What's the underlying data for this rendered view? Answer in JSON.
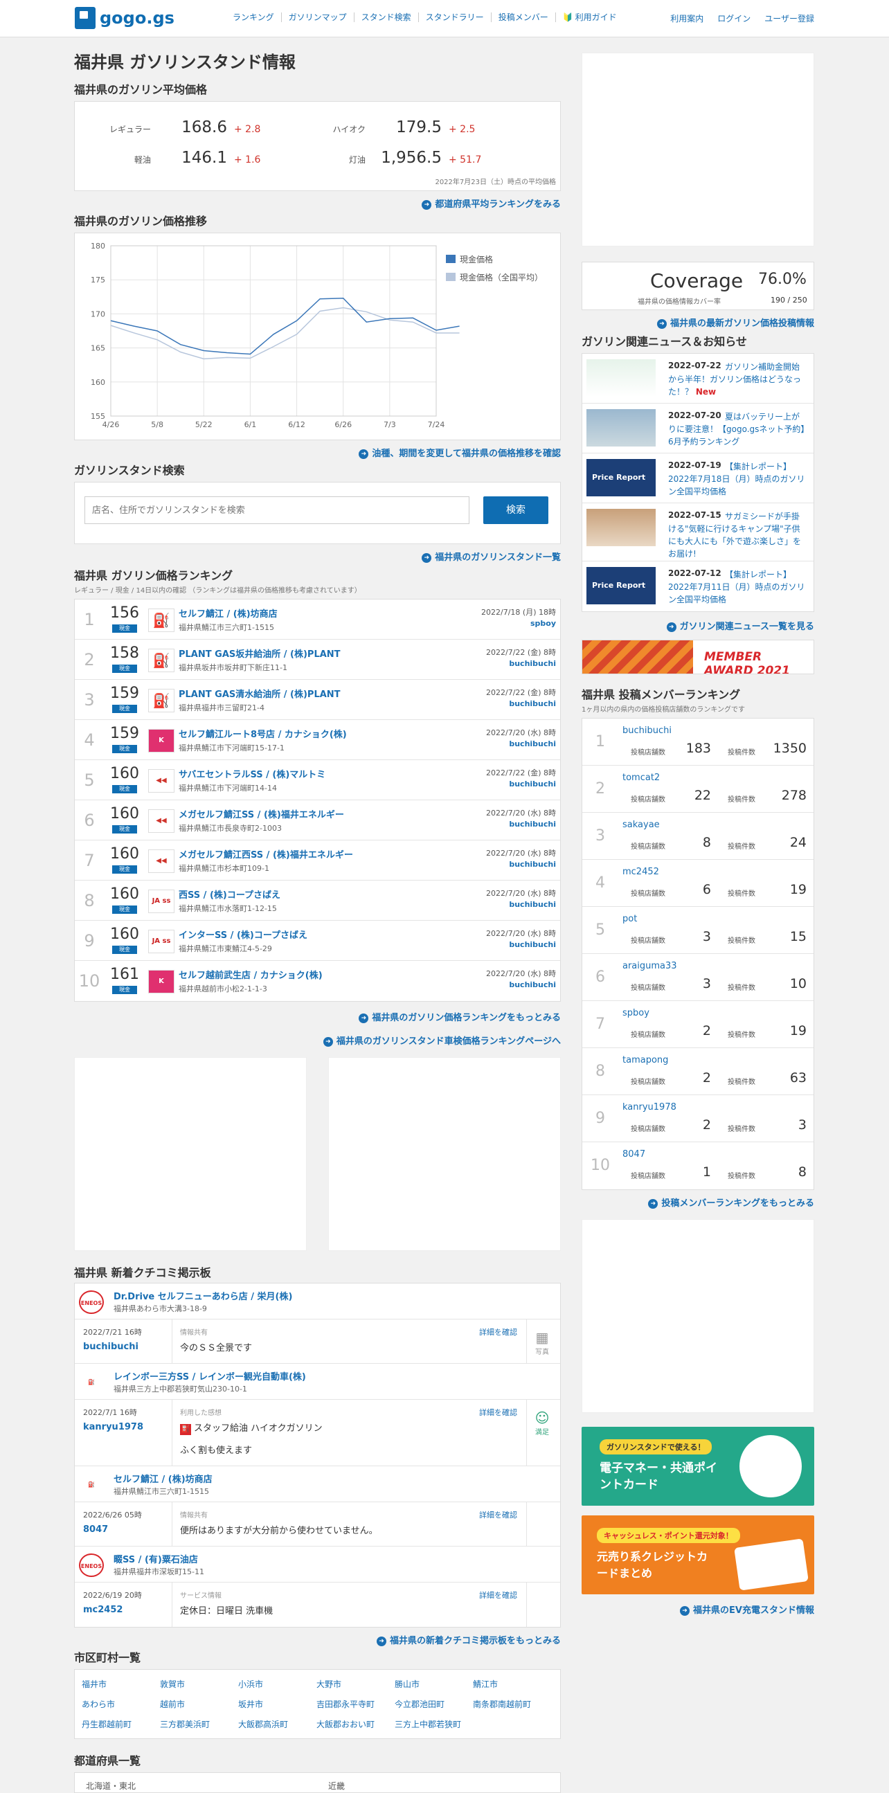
{
  "header": {
    "logo": "gogo.gs",
    "nav": [
      "ランキング",
      "ガソリンマップ",
      "スタンド検索",
      "スタンドラリー",
      "投稿メンバー",
      "利用ガイド"
    ],
    "right": [
      "利用案内",
      "ログイン",
      "ユーザー登録"
    ]
  },
  "page": {
    "title": "福井県 ガソリンスタンド情報"
  },
  "avg": {
    "heading": "福井県のガソリン平均価格",
    "items": [
      {
        "label": "レギュラー",
        "value": "168.6",
        "diff": "+ 2.8"
      },
      {
        "label": "ハイオク",
        "value": "179.5",
        "diff": "+ 2.5"
      },
      {
        "label": "軽油",
        "value": "146.1",
        "diff": "+ 1.6"
      },
      {
        "label": "灯油",
        "value": "1,956.5",
        "diff": "+ 51.7"
      }
    ],
    "note": "2022年7月23日（土）時点の平均価格",
    "more": "都道府県平均ランキングをみる"
  },
  "chart": {
    "heading": "福井県のガソリン価格推移",
    "more": "油種、期間を変更して福井県の価格推移を確認"
  },
  "chart_data": {
    "type": "line",
    "title": "",
    "xlabel": "",
    "ylabel": "",
    "ylim": [
      155,
      180
    ],
    "yticks": [
      "180",
      "175",
      "170",
      "165",
      "160",
      "155"
    ],
    "x": [
      "4/26",
      "5/8",
      "5/22",
      "6/1",
      "6/12",
      "6/26",
      "7/3",
      "7/24"
    ],
    "grid": true,
    "legend": "top-right",
    "series": [
      {
        "name": "現金価格",
        "color": "#3a76b8",
        "points": [
          [
            0,
            169
          ],
          [
            0.5,
            168.2
          ],
          [
            1,
            167.5
          ],
          [
            1.5,
            165.5
          ],
          [
            2,
            164.6
          ],
          [
            2.5,
            164.3
          ],
          [
            3,
            164.1
          ],
          [
            3.5,
            167
          ],
          [
            4,
            169
          ],
          [
            4.5,
            172.2
          ],
          [
            5,
            172.3
          ],
          [
            5.5,
            168.8
          ],
          [
            6,
            169.3
          ],
          [
            6.5,
            169.4
          ],
          [
            7,
            167.6
          ],
          [
            7.5,
            168.2
          ]
        ]
      },
      {
        "name": "現金価格（全国平均）",
        "color": "#b7c6dc",
        "points": [
          [
            0,
            168.3
          ],
          [
            0.5,
            167.2
          ],
          [
            1,
            166.2
          ],
          [
            1.5,
            164.4
          ],
          [
            2,
            163.4
          ],
          [
            2.5,
            163.6
          ],
          [
            3,
            163.5
          ],
          [
            3.5,
            165.2
          ],
          [
            4,
            167
          ],
          [
            4.5,
            170.4
          ],
          [
            5,
            170.9
          ],
          [
            5.5,
            170.3
          ],
          [
            6,
            169.1
          ],
          [
            6.5,
            168.8
          ],
          [
            7,
            167.2
          ],
          [
            7.5,
            167.2
          ]
        ]
      }
    ]
  },
  "search": {
    "heading": "ガソリンスタンド検索",
    "placeholder": "店名、住所でガソリンスタンドを検索",
    "button": "検索",
    "more": "福井県のガソリンスタンド一覧"
  },
  "ranking": {
    "heading": "福井県 ガソリン価格ランキング",
    "sub": "レギュラー / 現金 / 14日以内の確認 （ランキングは福井県の価格推移も考慮されています）",
    "tag": "現金",
    "rows": [
      {
        "no": "1",
        "price": "156",
        "name": "セルフ鯖江 / (株)坊商店",
        "addr": "福井県鯖江市三六町1-1515",
        "date": "2022/7/18 (月) 18時",
        "user": "spboy",
        "icon": "pump"
      },
      {
        "no": "2",
        "price": "158",
        "name": "PLANT GAS坂井給油所 / (株)PLANT",
        "addr": "福井県坂井市坂井町下新庄11-1",
        "date": "2022/7/22 (金) 8時",
        "user": "buchibuchi",
        "icon": "pump"
      },
      {
        "no": "3",
        "price": "159",
        "name": "PLANT GAS清水給油所 / (株)PLANT",
        "addr": "福井県福井市三留町21-4",
        "date": "2022/7/22 (金) 8時",
        "user": "buchibuchi",
        "icon": "pump"
      },
      {
        "no": "4",
        "price": "159",
        "name": "セルフ鯖江ルート8号店 / カナショク(株)",
        "addr": "福井県鯖江市下河端町15-17-1",
        "date": "2022/7/20 (水) 8時",
        "user": "buchibuchi",
        "icon": "kana"
      },
      {
        "no": "5",
        "price": "160",
        "name": "サバエセントラルSS / (株)マルトミ",
        "addr": "福井県鯖江市下河端町14-14",
        "date": "2022/7/22 (金) 8時",
        "user": "buchibuchi",
        "icon": "apollo"
      },
      {
        "no": "6",
        "price": "160",
        "name": "メガセルフ鯖江SS / (株)福井エネルギー",
        "addr": "福井県鯖江市長泉寺町2-1003",
        "date": "2022/7/20 (水) 8時",
        "user": "buchibuchi",
        "icon": "apollo"
      },
      {
        "no": "7",
        "price": "160",
        "name": "メガセルフ鯖江西SS / (株)福井エネルギー",
        "addr": "福井県鯖江市杉本町109-1",
        "date": "2022/7/20 (水) 8時",
        "user": "buchibuchi",
        "icon": "apollo"
      },
      {
        "no": "8",
        "price": "160",
        "name": "西SS / (株)コープさばえ",
        "addr": "福井県鯖江市水落町1-12-15",
        "date": "2022/7/20 (水) 8時",
        "user": "buchibuchi",
        "icon": "ja"
      },
      {
        "no": "9",
        "price": "160",
        "name": "インターSS / (株)コープさばえ",
        "addr": "福井県鯖江市東鯖江4-5-29",
        "date": "2022/7/20 (水) 8時",
        "user": "buchibuchi",
        "icon": "ja"
      },
      {
        "no": "10",
        "price": "161",
        "name": "セルフ越前武生店 / カナショク(株)",
        "addr": "福井県越前市小松2-1-1-3",
        "date": "2022/7/20 (水) 8時",
        "user": "buchibuchi",
        "icon": "kana"
      }
    ],
    "more1": "福井県のガソリン価格ランキングをもっとみる",
    "more2": "福井県のガソリンスタンド車検価格ランキングページへ"
  },
  "bbs": {
    "heading": "福井県 新着クチコミ掲示板",
    "detail": "詳細を確認",
    "items": [
      {
        "shop": "Dr.Drive セルフニューあわら店 / 栄月(株)",
        "addr": "福井県あわら市大溝3-18-9",
        "icon": "eneos",
        "date": "2022/7/21 16時",
        "user": "buchibuchi",
        "cat": "情報共有",
        "text": "今のＳＳ全景です",
        "side": "写真"
      },
      {
        "shop": "レインボー三方SS / レインボー観光自動車(株)",
        "addr": "福井県三方上中郡若狭町気山230-10-1",
        "icon": "pump",
        "date": "2022/7/1 16時",
        "user": "kanryu1978",
        "cat": "利用した感想",
        "text": "スタッフ給油 ハイオクガソリン",
        "text2": "ふく割も使えます",
        "side": "満足"
      },
      {
        "shop": "セルフ鯖江 / (株)坊商店",
        "addr": "福井県鯖江市三六町1-1515",
        "icon": "pump",
        "date": "2022/6/26 05時",
        "user": "8047",
        "cat": "情報共有",
        "text": "便所はありますが大分前から使わせていません。",
        "side": ""
      },
      {
        "shop": "畷SS / (有)粟石油店",
        "addr": "福井県福井市深坂町15-11",
        "icon": "eneos",
        "date": "2022/6/19 20時",
        "user": "mc2452",
        "cat": "サービス情報",
        "text": "定休日：日曜日 洗車機",
        "side": ""
      }
    ],
    "more": "福井県の新着クチコミ掲示板をもっとみる"
  },
  "cities": {
    "heading": "市区町村一覧",
    "items": [
      "福井市",
      "敦賀市",
      "小浜市",
      "大野市",
      "勝山市",
      "鯖江市",
      "あわら市",
      "越前市",
      "坂井市",
      "吉田郡永平寺町",
      "今立郡池田町",
      "南条郡南越前町",
      "丹生郡越前町",
      "三方郡美浜町",
      "大飯郡高浜町",
      "大飯郡おおい町",
      "三方上中郡若狭町"
    ]
  },
  "prefs": {
    "heading": "都道府県一覧",
    "items": [
      "北海道・東北",
      "近畿"
    ]
  },
  "coverage": {
    "title": "Coverage",
    "pct": "76.0%",
    "label": "福井県の価格情報カバー率",
    "count": "190 / 250",
    "more": "福井県の最新ガソリン価格投稿情報"
  },
  "news": {
    "heading": "ガソリン関連ニュース＆お知らせ",
    "items": [
      {
        "date": "2022-07-22",
        "title": "ガソリン補助金開始から半年！ガソリン価格はどうなった！？",
        "new": "New"
      },
      {
        "date": "2022-07-20",
        "title": "夏はバッテリー上がりに要注意！【gogo.gsネット予約】6月予約ランキング"
      },
      {
        "date": "2022-07-19",
        "title": "【集計レポート】2022年7月18日（月）時点のガソリン全国平均価格"
      },
      {
        "date": "2022-07-15",
        "title": "サガミシードが手掛ける\"気軽に行けるキャンプ場\"子供にも大人にも「外で遊ぶ楽しさ」をお届け!"
      },
      {
        "date": "2022-07-12",
        "title": "【集計レポート】2022年7月11日（月）時点のガソリン全国平均価格"
      }
    ],
    "more": "ガソリン関連ニュース一覧を見る",
    "award": "MEMBER AWARD 2021",
    "report": "Price Report"
  },
  "members": {
    "heading": "福井県 投稿メンバーランキング",
    "sub": "1ヶ月以内の県内の価格投稿店舗数のランキングです",
    "l1": "投稿店舗数",
    "l2": "投稿件数",
    "items": [
      {
        "no": "1",
        "name": "buchibuchi",
        "stores": "183",
        "posts": "1350"
      },
      {
        "no": "2",
        "name": "tomcat2",
        "stores": "22",
        "posts": "278"
      },
      {
        "no": "3",
        "name": "sakayae",
        "stores": "8",
        "posts": "24"
      },
      {
        "no": "4",
        "name": "mc2452",
        "stores": "6",
        "posts": "19"
      },
      {
        "no": "5",
        "name": "pot",
        "stores": "3",
        "posts": "15"
      },
      {
        "no": "6",
        "name": "araiguma33",
        "stores": "3",
        "posts": "10"
      },
      {
        "no": "7",
        "name": "spboy",
        "stores": "2",
        "posts": "19"
      },
      {
        "no": "8",
        "name": "tamapong",
        "stores": "2",
        "posts": "63"
      },
      {
        "no": "9",
        "name": "kanryu1978",
        "stores": "2",
        "posts": "3"
      },
      {
        "no": "10",
        "name": "8047",
        "stores": "1",
        "posts": "8"
      }
    ],
    "more": "投稿メンバーランキングをもっとみる"
  },
  "banners": {
    "b1_tag": "ガソリンスタンドで使える！",
    "b1_text": "電子マネー・共通ポイントカード",
    "b2_tag": "キャッシュレス・ポイント還元対象！",
    "b2_text": "元売り系クレジットカードまとめ",
    "more": "福井県のEV充電スタンド情報"
  },
  "colors": {
    "brand": "#0f6db2",
    "link": "#1a6fb3",
    "up": "#d0342c"
  }
}
